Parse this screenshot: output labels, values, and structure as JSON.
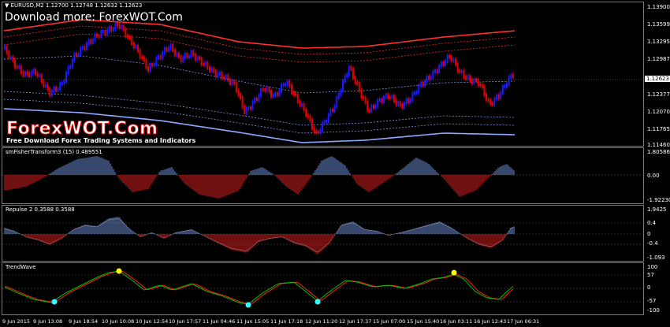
{
  "main_chart": {
    "symbol_label": "▼ EURUSD,M2  1.12700 1.12748 1.12632 1.12623",
    "watermark": "Download more: ForexWOT.Com",
    "brand": "ForexWOT.Com",
    "brand_subtitle": "Free Download Forex Trading Systems and Indicators",
    "current_price": "1.12623",
    "price_axis": [
      "1.13900",
      "1.13599",
      "1.13295",
      "1.12987",
      "1.12683",
      "1.12377",
      "1.12070",
      "1.11765",
      "1.11460"
    ]
  },
  "fisher": {
    "label": "smFisherTransform3 (15) 0.489551",
    "axis": [
      "1.805862",
      "0.00",
      "-1.922300"
    ]
  },
  "repulse": {
    "label": "Repulse 2 0.3588 0.3588",
    "axis": [
      "1.9425",
      "0.4",
      "0",
      "-0.4",
      "-1.093"
    ]
  },
  "trendwave": {
    "label": "TrendWave",
    "axis": [
      "100",
      "57",
      "0",
      "-57",
      "-100"
    ]
  },
  "time_axis": [
    "9 Jun 2015",
    "9 Jun 13:08",
    "9 Jun 18:54",
    "10 Jun 10:08",
    "10 Jun 12:54",
    "10 Jun 17:57",
    "11 Jun 04:46",
    "11 Jun 15:05",
    "11 Jun 17:18",
    "12 Jun 11:20",
    "12 Jun 17:37",
    "15 Jun 07:00",
    "15 Jun 15:40",
    "16 Jun 03:11",
    "16 Jun 12:43",
    "17 Jun 06:31"
  ],
  "colors": {
    "bull": "#1a1aff",
    "bear": "#e00000",
    "hist_pos": "#6f8fd8",
    "hist_neg": "#e02020",
    "band_red": "#ff3030",
    "band_blue": "#8fa8ff",
    "wave_green": "#00c000",
    "wave_red": "#ff2020",
    "dot_yellow": "#ffff00",
    "dot_cyan": "#33ffff"
  }
}
